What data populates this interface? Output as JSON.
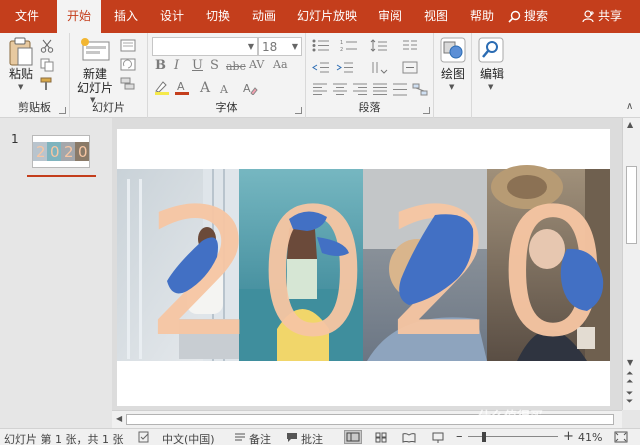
{
  "tabs": [
    {
      "label": "文件",
      "active": false
    },
    {
      "label": "开始",
      "active": true
    },
    {
      "label": "插入",
      "active": false
    },
    {
      "label": "设计",
      "active": false
    },
    {
      "label": "切换",
      "active": false
    },
    {
      "label": "动画",
      "active": false
    },
    {
      "label": "幻灯片放映",
      "active": false
    },
    {
      "label": "审阅",
      "active": false
    },
    {
      "label": "视图",
      "active": false
    },
    {
      "label": "帮助",
      "active": false
    }
  ],
  "search_label": "搜索",
  "share_label": "共享",
  "ribbon": {
    "clipboard": {
      "paste_label": "粘贴",
      "group_label": "剪贴板"
    },
    "slides": {
      "new_slide_label": "新建\n幻灯片",
      "group_label": "幻灯片"
    },
    "font": {
      "font_name": "",
      "font_size": "18",
      "group_label": "字体"
    },
    "paragraph": {
      "group_label": "段落"
    },
    "drawing": {
      "label": "绘图"
    },
    "editing": {
      "label": "编辑"
    }
  },
  "thumbnails": {
    "slide_number": "1"
  },
  "slide": {
    "text": "2020"
  },
  "status": {
    "slide_info": "幻灯片 第 1 张，共 1 张",
    "language": "中文(中国)",
    "notes": "备注",
    "comments": "批注",
    "zoom": "41%"
  },
  "watermark": "什么值得买",
  "colors": {
    "accent": "#c43e1c",
    "digit_fill": "#f7c6a3",
    "blue_shape": "#4270c4"
  }
}
